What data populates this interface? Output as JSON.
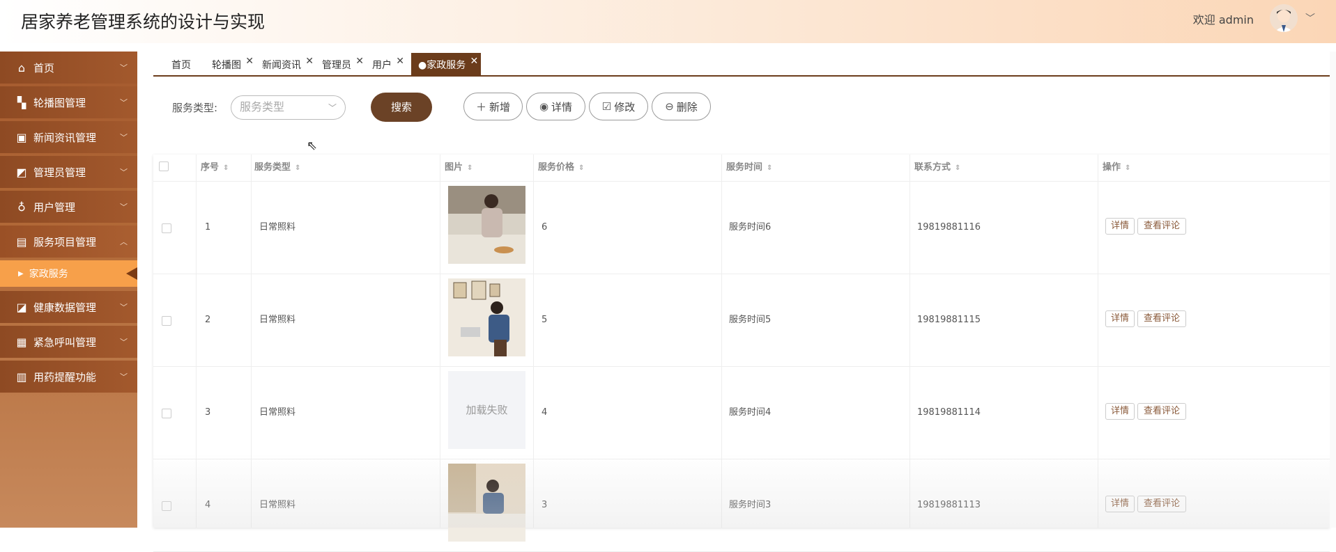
{
  "header": {
    "title": "居家养老管理系统的设计与实现",
    "welcome": "欢迎 admin"
  },
  "sidebar": {
    "items": [
      {
        "label": "首页",
        "icon": "home-icon"
      },
      {
        "label": "轮播图管理",
        "icon": "grid-icon"
      },
      {
        "label": "新闻资讯管理",
        "icon": "news-icon"
      },
      {
        "label": "管理员管理",
        "icon": "admin-icon"
      },
      {
        "label": "用户管理",
        "icon": "user-icon"
      },
      {
        "label": "服务项目管理",
        "icon": "service-icon",
        "open": true
      },
      {
        "label": "健康数据管理",
        "icon": "health-icon"
      },
      {
        "label": "紧急呼叫管理",
        "icon": "emergency-icon"
      },
      {
        "label": "用药提醒功能",
        "icon": "medicine-icon"
      }
    ],
    "active_sub": "家政服务"
  },
  "tabs": [
    {
      "label": "首页",
      "closable": false
    },
    {
      "label": "轮播图",
      "closable": true
    },
    {
      "label": "新闻资讯",
      "closable": true
    },
    {
      "label": "管理员",
      "closable": true
    },
    {
      "label": "用户",
      "closable": true
    },
    {
      "label": "●家政服务",
      "closable": true,
      "active": true
    }
  ],
  "search": {
    "label": "服务类型:",
    "placeholder": "服务类型",
    "button": "搜索"
  },
  "toolbar": {
    "add": "新增",
    "detail": "详情",
    "edit": "修改",
    "delete": "删除"
  },
  "table": {
    "headers": [
      "序号",
      "服务类型",
      "图片",
      "服务价格",
      "服务时间",
      "联系方式",
      "操作"
    ],
    "rows": [
      {
        "id": "1",
        "type": "日常照料",
        "image": "photo",
        "price": "6",
        "time": "服务时间6",
        "contact": "19819881116"
      },
      {
        "id": "2",
        "type": "日常照料",
        "image": "photo",
        "price": "5",
        "time": "服务时间5",
        "contact": "19819881115"
      },
      {
        "id": "3",
        "type": "日常照料",
        "image": "加载失败",
        "price": "4",
        "time": "服务时间4",
        "contact": "19819881114"
      },
      {
        "id": "4",
        "type": "日常照料",
        "image": "photo",
        "price": "3",
        "time": "服务时间3",
        "contact": "19819881113"
      }
    ],
    "op_detail": "详情",
    "op_comment": "查看评论"
  },
  "colors": {
    "brand": "#6b4226",
    "sidebar": "#a55a2e",
    "active_sub": "#f7a04a",
    "header_accent": "#fbd6b6"
  }
}
